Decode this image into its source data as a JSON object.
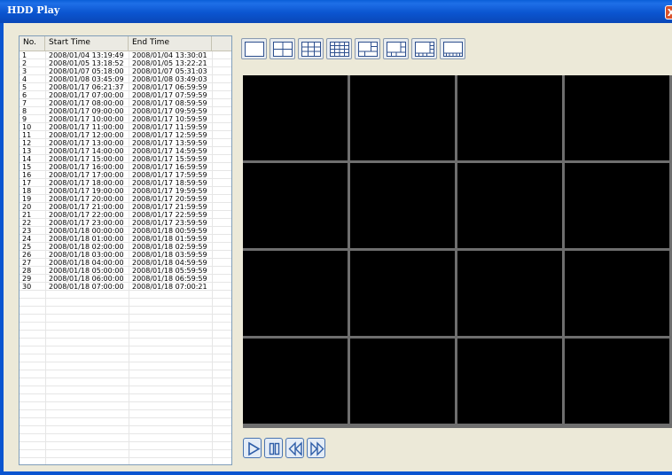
{
  "window": {
    "title": "HDD Play",
    "close_glyph": "X"
  },
  "table": {
    "columns": [
      "No.",
      "Start Time",
      "End Time"
    ],
    "rows": [
      [
        "1",
        "2008/01/04 13:19:49",
        "2008/01/04 13:30:01"
      ],
      [
        "2",
        "2008/01/05 13:18:52",
        "2008/01/05 13:22:21"
      ],
      [
        "3",
        "2008/01/07 05:18:00",
        "2008/01/07 05:31:03"
      ],
      [
        "4",
        "2008/01/08 03:45:09",
        "2008/01/08 03:49:03"
      ],
      [
        "5",
        "2008/01/17 06:21:37",
        "2008/01/17 06:59:59"
      ],
      [
        "6",
        "2008/01/17 07:00:00",
        "2008/01/17 07:59:59"
      ],
      [
        "7",
        "2008/01/17 08:00:00",
        "2008/01/17 08:59:59"
      ],
      [
        "8",
        "2008/01/17 09:00:00",
        "2008/01/17 09:59:59"
      ],
      [
        "9",
        "2008/01/17 10:00:00",
        "2008/01/17 10:59:59"
      ],
      [
        "10",
        "2008/01/17 11:00:00",
        "2008/01/17 11:59:59"
      ],
      [
        "11",
        "2008/01/17 12:00:00",
        "2008/01/17 12:59:59"
      ],
      [
        "12",
        "2008/01/17 13:00:00",
        "2008/01/17 13:59:59"
      ],
      [
        "13",
        "2008/01/17 14:00:00",
        "2008/01/17 14:59:59"
      ],
      [
        "14",
        "2008/01/17 15:00:00",
        "2008/01/17 15:59:59"
      ],
      [
        "15",
        "2008/01/17 16:00:00",
        "2008/01/17 16:59:59"
      ],
      [
        "16",
        "2008/01/17 17:00:00",
        "2008/01/17 17:59:59"
      ],
      [
        "17",
        "2008/01/17 18:00:00",
        "2008/01/17 18:59:59"
      ],
      [
        "18",
        "2008/01/17 19:00:00",
        "2008/01/17 19:59:59"
      ],
      [
        "19",
        "2008/01/17 20:00:00",
        "2008/01/17 20:59:59"
      ],
      [
        "20",
        "2008/01/17 21:00:00",
        "2008/01/17 21:59:59"
      ],
      [
        "21",
        "2008/01/17 22:00:00",
        "2008/01/17 22:59:59"
      ],
      [
        "22",
        "2008/01/17 23:00:00",
        "2008/01/17 23:59:59"
      ],
      [
        "23",
        "2008/01/18 00:00:00",
        "2008/01/18 00:59:59"
      ],
      [
        "24",
        "2008/01/18 01:00:00",
        "2008/01/18 01:59:59"
      ],
      [
        "25",
        "2008/01/18 02:00:00",
        "2008/01/18 02:59:59"
      ],
      [
        "26",
        "2008/01/18 03:00:00",
        "2008/01/18 03:59:59"
      ],
      [
        "27",
        "2008/01/18 04:00:00",
        "2008/01/18 04:59:59"
      ],
      [
        "28",
        "2008/01/18 05:00:00",
        "2008/01/18 05:59:59"
      ],
      [
        "29",
        "2008/01/18 06:00:00",
        "2008/01/18 06:59:59"
      ],
      [
        "30",
        "2008/01/18 07:00:00",
        "2008/01/18 07:00:21"
      ]
    ]
  },
  "layout_buttons": [
    {
      "name": "layout-1x1-button",
      "icon": "single-view-icon"
    },
    {
      "name": "layout-2x2-button",
      "icon": "quad-view-icon"
    },
    {
      "name": "layout-3x3-button",
      "icon": "nine-view-icon"
    },
    {
      "name": "layout-4x4-button",
      "icon": "sixteen-view-icon"
    },
    {
      "name": "layout-1plus5-button",
      "icon": "six-view-icon"
    },
    {
      "name": "layout-1plus7-button",
      "icon": "eight-view-icon"
    },
    {
      "name": "layout-1plus9-button",
      "icon": "ten-view-icon"
    },
    {
      "name": "layout-1plus12-button",
      "icon": "thirteen-view-icon"
    }
  ],
  "video_grid": {
    "rows": 4,
    "cols": 4
  },
  "playback_buttons": [
    {
      "name": "play-button",
      "icon": "play-icon"
    },
    {
      "name": "pause-button",
      "icon": "pause-icon"
    },
    {
      "name": "rewind-button",
      "icon": "rewind-icon"
    },
    {
      "name": "fast-forward-button",
      "icon": "fast-forward-icon"
    }
  ],
  "colors": {
    "titlebar": "#0B55D0",
    "video_bg": "#000000",
    "video_grid": "#6E6E6E",
    "window_bg": "#ECE9D8"
  }
}
